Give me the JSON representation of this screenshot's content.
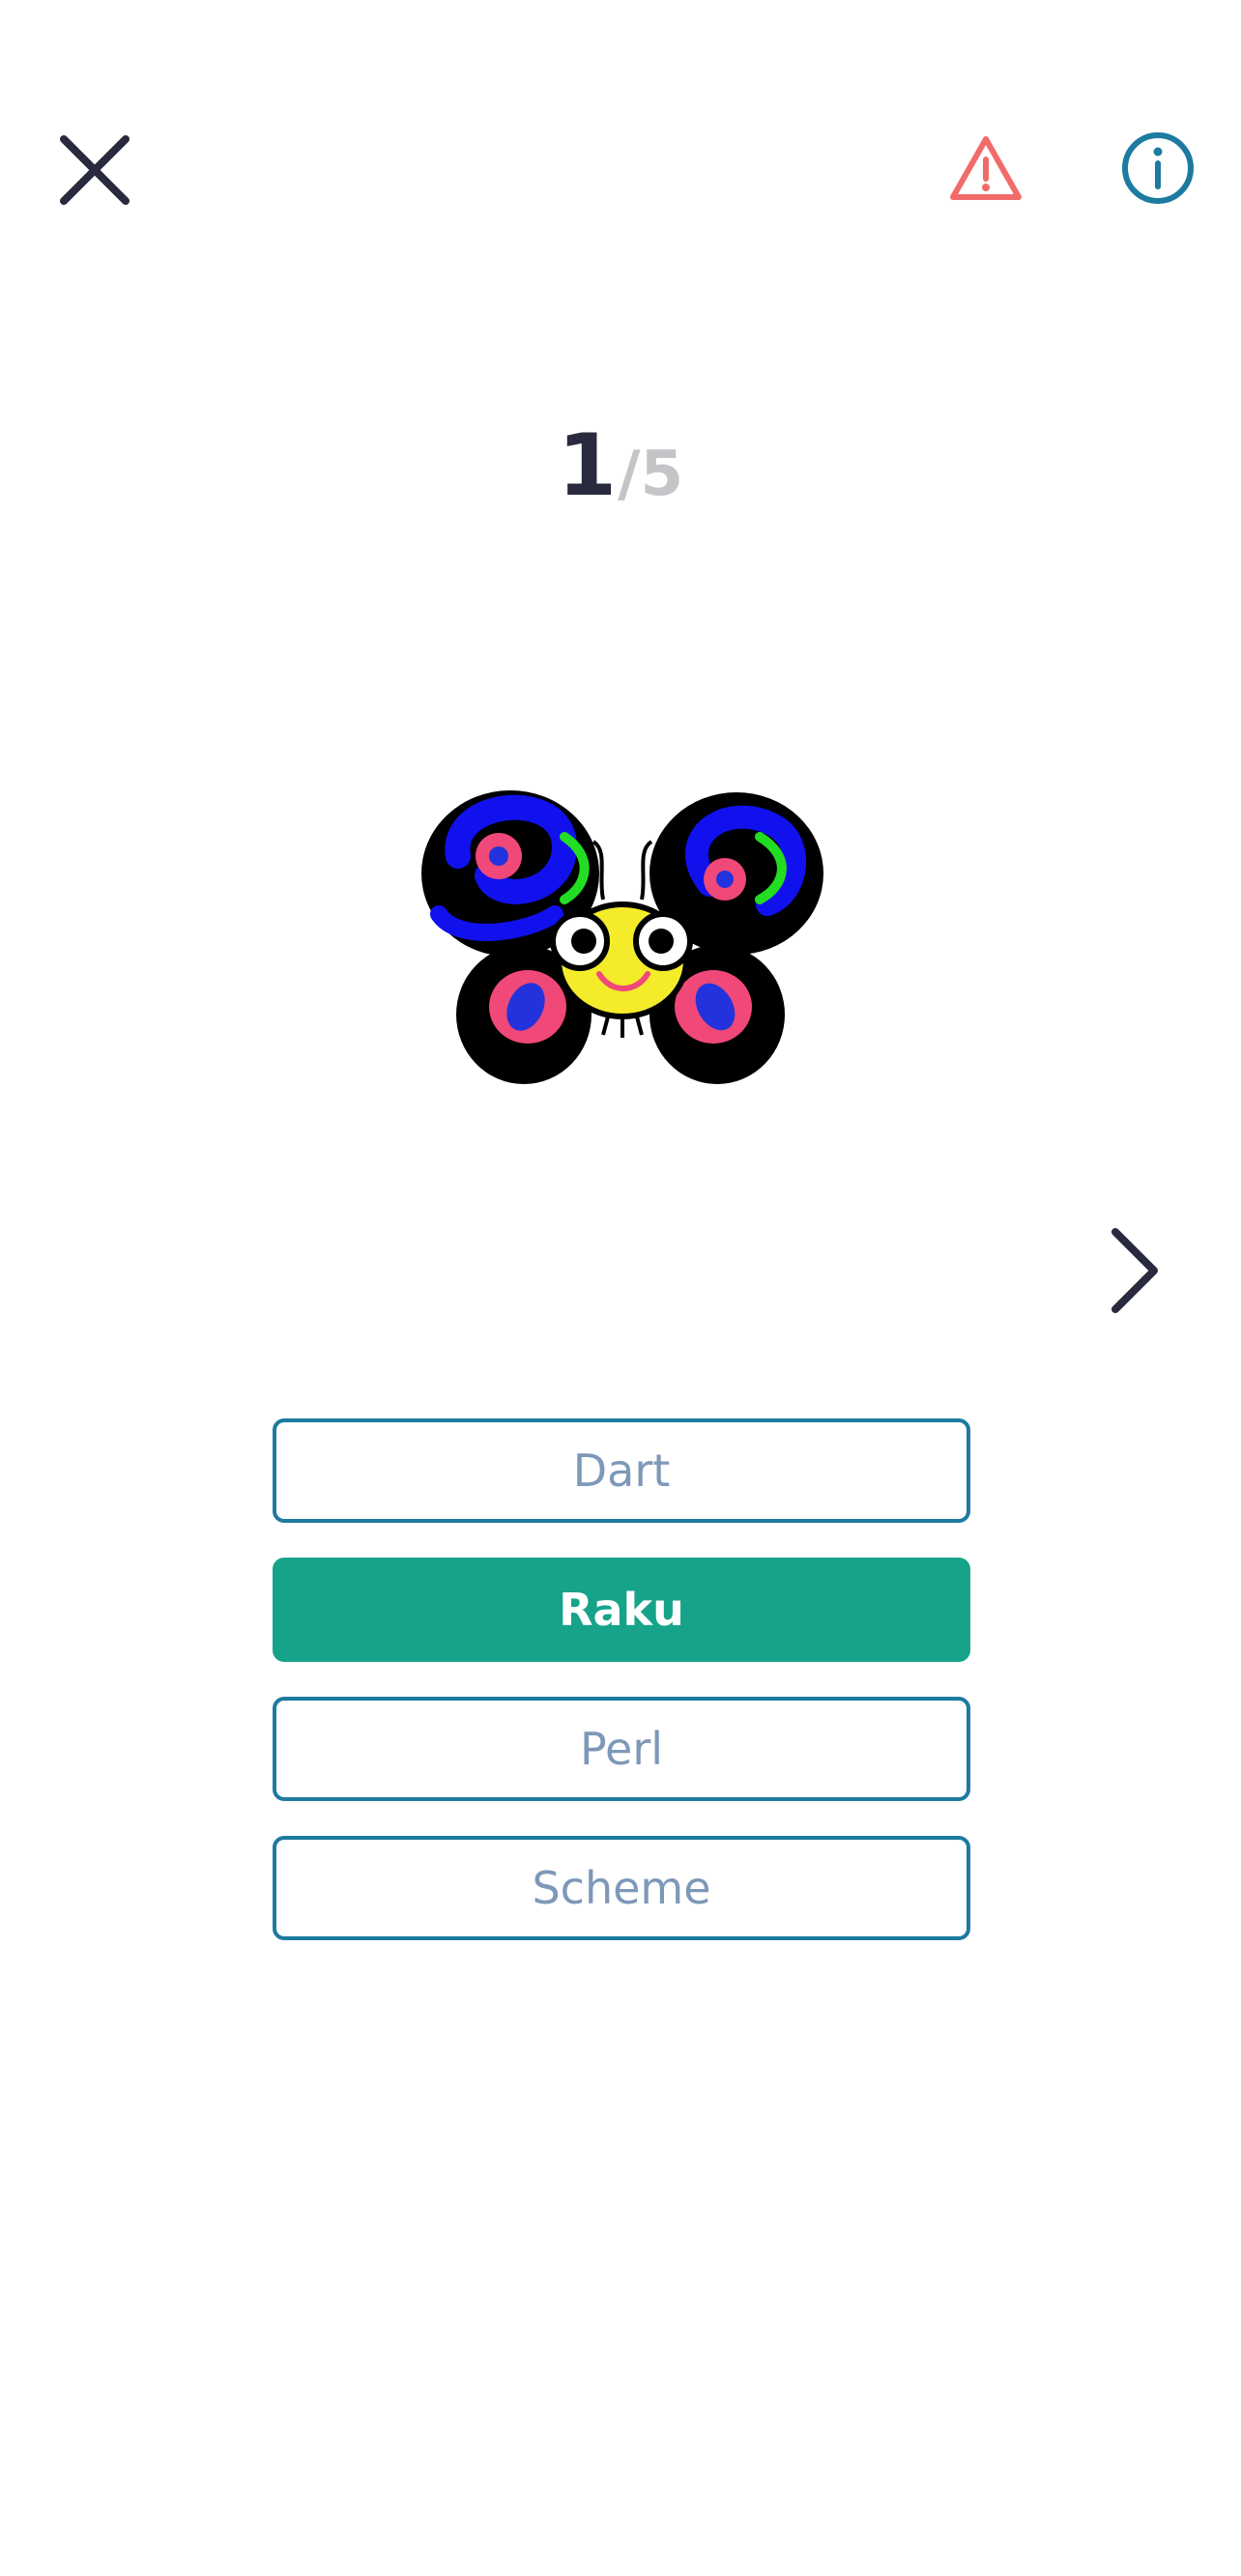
{
  "header": {
    "close_icon": "close-icon",
    "report_icon": "warning-triangle-icon",
    "info_icon": "info-circle-icon"
  },
  "progress": {
    "current": "1",
    "separator": "/",
    "total": "5"
  },
  "question": {
    "image": "butterfly-logo-illustration"
  },
  "navigation": {
    "next_icon": "chevron-right-icon"
  },
  "answers": [
    {
      "label": "Dart",
      "selected": false
    },
    {
      "label": "Raku",
      "selected": true
    },
    {
      "label": "Perl",
      "selected": false
    },
    {
      "label": "Scheme",
      "selected": false
    }
  ],
  "colors": {
    "primary_border": "#1d7aa0",
    "selected_fill": "#16a389",
    "report": "#f26b6b",
    "info": "#1d7aa0"
  }
}
